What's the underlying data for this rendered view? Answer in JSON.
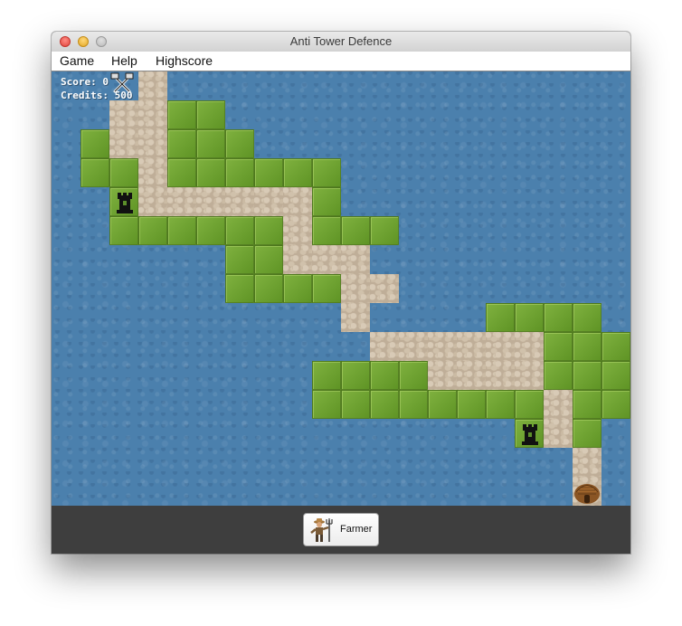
{
  "window": {
    "title": "Anti Tower Defence"
  },
  "menu": {
    "items": [
      "Game",
      "Help",
      "Highscore"
    ]
  },
  "hud": {
    "score_label": "Score:",
    "score": "0",
    "credits_label": "Credits:",
    "credits": "500"
  },
  "bottom_bar": {
    "unit_button_label": "Farmer",
    "unit_icon": "farmer-icon"
  },
  "map": {
    "cols": 20,
    "rows": 15,
    "legend": {
      ".": "water",
      "G": "grass",
      "R": "road",
      "T": "tower",
      "H": "goal-hut"
    },
    "grid": [
      "...R................",
      "..RRGG..............",
      ".GRRGGG.............",
      ".GGRGGGGGG..........",
      "..TRRRRRRG..........",
      "..GGGGGGRGGG........",
      "......GGRRR.........",
      "......GGGGRR........",
      "..........R....GGGG.",
      "...........RRRRRRGGG",
      ".........GGGGRRRRGGG",
      ".........GGGGGGGGRGG",
      "................TRG.",
      "..................R.",
      "..................H."
    ]
  },
  "sprites": {
    "tower_icon": "tower-icon",
    "goal_icon": "hut-icon",
    "spawn_icon": "crossed-tools-icon"
  },
  "colors": {
    "water": "#4b80ad",
    "grass": "#6ea031",
    "road": "#bfae98",
    "toolbar": "#3e3e3e"
  }
}
